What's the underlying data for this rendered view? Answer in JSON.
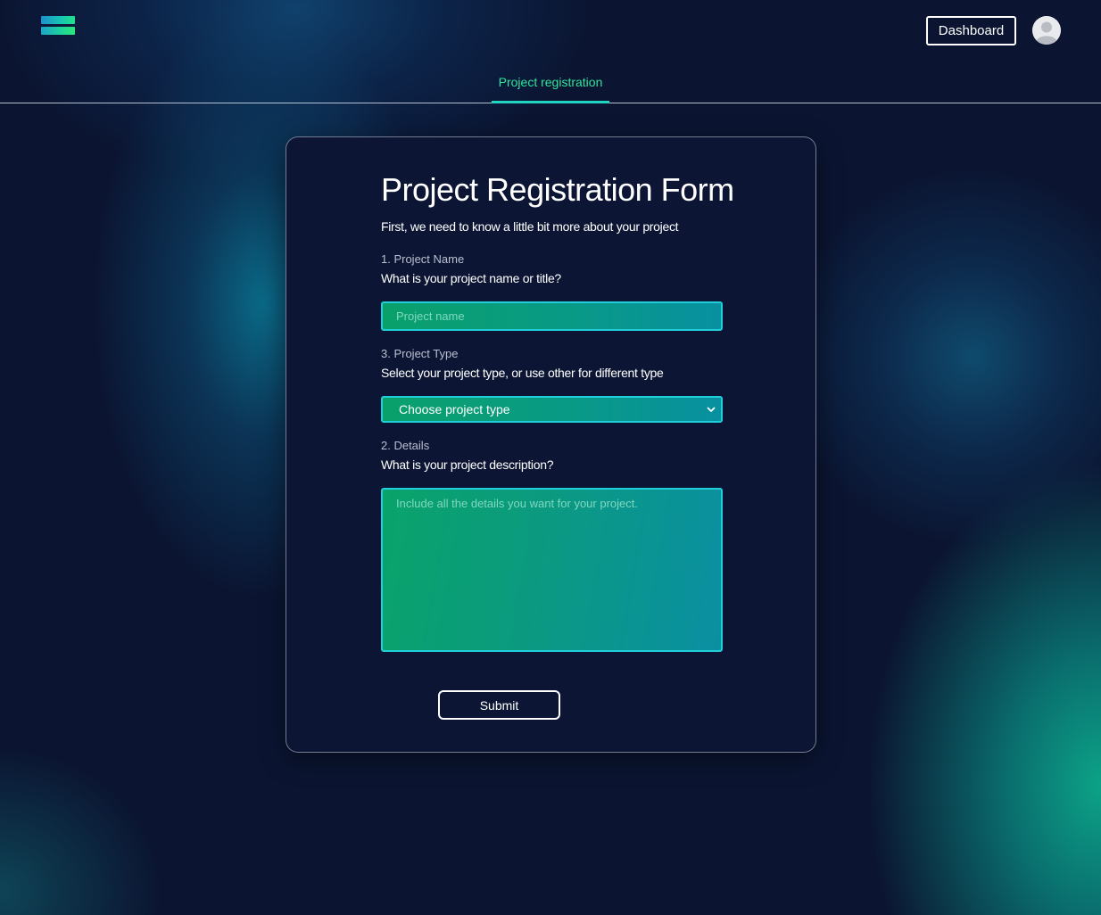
{
  "header": {
    "logo_icon": "menu-logo-icon",
    "dashboard_label": "Dashboard",
    "avatar_icon": "user-avatar-icon",
    "tab_label": "Project registration"
  },
  "form": {
    "title": "Project Registration Form",
    "subtitle": "First, we need to know a little bit more about your project",
    "project_name": {
      "number_label": "1. Project Name",
      "question": "What is your project name or title?",
      "placeholder": "Project name",
      "value": ""
    },
    "project_type": {
      "number_label": "3. Project Type",
      "question": "Select your project type, or use other for different type",
      "selected": "Choose project type"
    },
    "details": {
      "number_label": "2. Details",
      "question": "What is your project description?",
      "placeholder": "Include all the details you want for your project.",
      "value": ""
    },
    "submit_label": "Submit"
  },
  "colors": {
    "background": "#0b1532",
    "accent": "#2fe39b",
    "tab_underline": "#22d3c2",
    "field_border": "#20cfd9"
  }
}
